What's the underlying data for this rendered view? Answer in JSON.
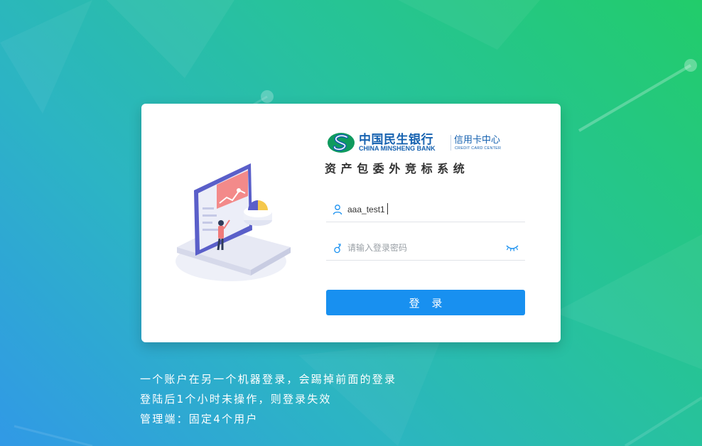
{
  "bank": {
    "name_cn": "中国民生银行",
    "name_en": "CHINA MINSHENG BANK",
    "center_cn": "信用卡中心",
    "center_en": "CREDIT CARD CENTER"
  },
  "system_title": "资产包委外竞标系统",
  "login_form": {
    "username_value": "aaa_test1",
    "password_value": "",
    "password_placeholder": "请输入登录密码",
    "submit_label": "登 录"
  },
  "icons": {
    "logo": "minsheng-logo-icon",
    "username": "user-icon",
    "password": "key-icon",
    "toggle_visibility": "eye-closed-icon",
    "illustration": "dashboard-illustration"
  },
  "notes": [
    "一个账户在另一个机器登录，会踢掉前面的登录",
    "登陆后1个小时未操作，则登录失效",
    "管理端：固定4个用户"
  ],
  "colors": {
    "primary": "#1890f0",
    "brand": "#1662b0",
    "logo_green": "#0f9a5e",
    "bg_green": "#22cc6a",
    "bg_blue": "#3199e6"
  }
}
